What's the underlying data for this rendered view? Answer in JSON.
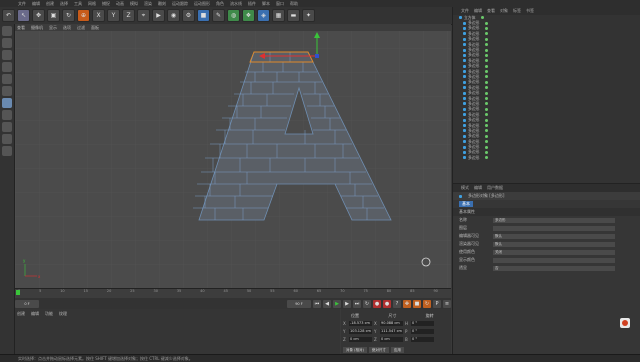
{
  "menubar": {
    "items": [
      "文件",
      "编辑",
      "创建",
      "选择",
      "工具",
      "网格",
      "捕捉",
      "动画",
      "模拟",
      "渲染",
      "雕刻",
      "运动跟踪",
      "运动图形",
      "角色",
      "流水线",
      "插件",
      "脚本",
      "窗口",
      "帮助"
    ]
  },
  "toolbar": {
    "icons": [
      "undo-icon",
      "move-icon",
      "scale-icon",
      "rotate-icon",
      "live-select-icon",
      "x-axis",
      "y-axis",
      "z-axis",
      "world-coord-icon",
      "render-view-icon",
      "render-icon",
      "render-settings-icon",
      "cube-icon",
      "pen-icon",
      "subdivide-icon",
      "array-icon",
      "deformer-icon",
      "scene-icon",
      "camera-icon",
      "light-icon"
    ],
    "axis_labels": [
      "X",
      "Y",
      "Z"
    ]
  },
  "viewport": {
    "menu": [
      "查看",
      "摄像机",
      "显示",
      "选项",
      "过滤",
      "面板"
    ],
    "axis_labels": {
      "x": "x",
      "y": "y"
    }
  },
  "timeline": {
    "ticks": [
      "0",
      "5",
      "10",
      "15",
      "20",
      "25",
      "30",
      "35",
      "40",
      "45",
      "50",
      "55",
      "60",
      "65",
      "70",
      "75",
      "80",
      "85",
      "90"
    ],
    "start": "0 F",
    "end": "90 F"
  },
  "material_panel": {
    "menu": [
      "创建",
      "编辑",
      "功能",
      "纹理"
    ]
  },
  "coordinates": {
    "headers": [
      "位置",
      "尺寸",
      "旋转"
    ],
    "rows": [
      {
        "axis": "X",
        "pos": "-18.573 cm",
        "size": "90.088 cm",
        "rot_axis": "H",
        "rot": "0 °"
      },
      {
        "axis": "Y",
        "pos": "103.128 cm",
        "size": "111.547 cm",
        "rot_axis": "P",
        "rot": "0 °"
      },
      {
        "axis": "Z",
        "pos": "0 cm",
        "size": "0 cm",
        "rot_axis": "B",
        "rot": "0 °"
      }
    ],
    "mode": "对象 (相对)",
    "size_mode": "绝对尺寸",
    "apply": "应用"
  },
  "object_manager": {
    "menu": [
      "文件",
      "编辑",
      "查看",
      "对象",
      "标签",
      "书签"
    ],
    "root": "立方体",
    "child_name": "多边形",
    "child_count": 26
  },
  "attributes": {
    "menu": [
      "模式",
      "编辑",
      "用户数据"
    ],
    "object_title": "多边形对象 [多边形]",
    "tab": "基本",
    "section": "基本属性",
    "fields": [
      {
        "label": "名称",
        "value": "多边形"
      },
      {
        "label": "图层",
        "value": ""
      },
      {
        "label": "编辑器可见",
        "value": "默认"
      },
      {
        "label": "渲染器可见",
        "value": "默认"
      },
      {
        "label": "使用颜色",
        "value": "关闭"
      },
      {
        "label": "显示颜色",
        "value": ""
      },
      {
        "label": "透显",
        "value": "否"
      }
    ]
  },
  "statusbar": {
    "text": "实时选择：点击并拖动鼠标选择元素。按住 SHIFT 键增加选择对象；按住 CTRL 键减少选择对象。"
  },
  "colors": {
    "bg": "#4b4b4b",
    "mesh_line": "#6f8fb3",
    "selection_edge": "#e08a2a"
  }
}
